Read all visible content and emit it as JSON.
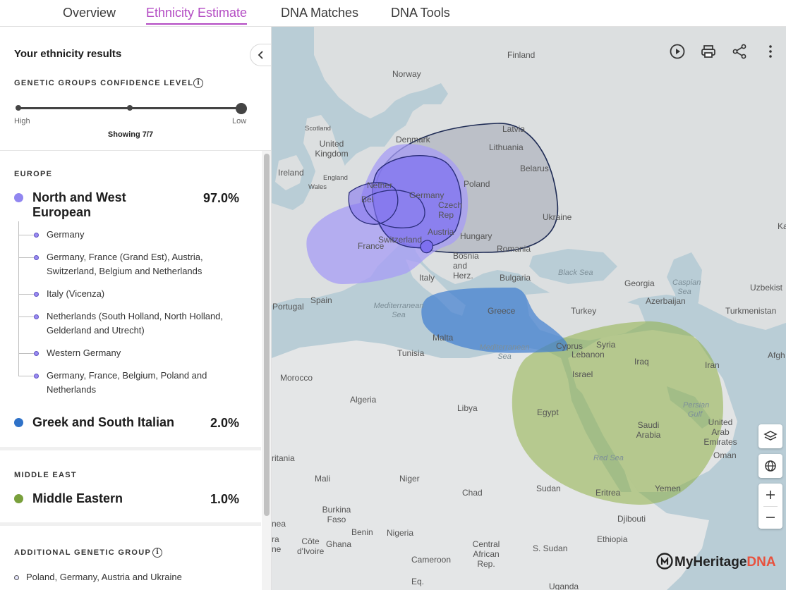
{
  "tabs": [
    {
      "label": "Overview"
    },
    {
      "label": "Ethnicity Estimate"
    },
    {
      "label": "DNA Matches"
    },
    {
      "label": "DNA Tools"
    }
  ],
  "panel": {
    "title": "Your ethnicity results",
    "confidence_label": "GENETIC GROUPS CONFIDENCE LEVEL",
    "slider": {
      "high_label": "High",
      "low_label": "Low",
      "level": 1.0
    },
    "showing": "Showing 7/7"
  },
  "sections": {
    "europe": {
      "title": "EUROPE",
      "groups": [
        {
          "name": "North and West European",
          "percent": "97.0%",
          "color": "#9186f0",
          "subgroups": [
            "Germany",
            "Germany, France (Grand Est), Austria, Switzerland, Belgium and Netherlands",
            "Italy (Vicenza)",
            "Netherlands (South Holland, North Holland, Gelderland and Utrecht)",
            "Western Germany",
            "Germany, France, Belgium, Poland and Netherlands"
          ]
        },
        {
          "name": "Greek and South Italian",
          "percent": "2.0%",
          "color": "#2f72c8"
        }
      ]
    },
    "middle_east": {
      "title": "MIDDLE EAST",
      "groups": [
        {
          "name": "Middle Eastern",
          "percent": "1.0%",
          "color": "#79a03c"
        }
      ]
    },
    "additional": {
      "title": "ADDITIONAL GENETIC GROUP",
      "items": [
        "Poland, Germany, Austria and Ukraine"
      ]
    }
  },
  "map": {
    "labels": {
      "finland": "Finland",
      "norway": "Norway",
      "latvia": "Latvia",
      "lithuania": "Lithuania",
      "denmark": "Denmark",
      "scotland": "Scotland",
      "uk": "United Kingdom",
      "ireland": "Ireland",
      "england": "England",
      "wales": "Wales",
      "netherlands": "Nether",
      "belarus": "Belarus",
      "poland": "Poland",
      "belgium": "Bel",
      "germany": "Germany",
      "czech": "Czech Rep",
      "ukraine": "Ukraine",
      "france": "France",
      "switzerland": "Switzerland",
      "austria": "Austria",
      "hungary": "Hungary",
      "romania": "Romania",
      "bosnia": "Bosnia and Herz.",
      "bulgaria": "Bulgaria",
      "italy": "Italy",
      "portugal": "Portugal",
      "spain": "Spain",
      "georgia": "Georgia",
      "azerbaijan": "Azerbaijan",
      "uzbekistan": "Uzbekist",
      "turkmenistan": "Turkmenistan",
      "turkey": "Turkey",
      "greece": "Greece",
      "syria": "Syria",
      "cyprus": "Cyprus",
      "lebanon": "Lebanon",
      "iraq": "Iraq",
      "iran": "Iran",
      "afghanistan": "Afgh",
      "kazakhstan": "Ka",
      "israel": "Israel",
      "malta": "Malta",
      "tunisia": "Tunisia",
      "morocco": "Morocco",
      "algeria": "Algeria",
      "libya": "Libya",
      "egypt": "Egypt",
      "saudi": "Saudi Arabia",
      "uae": "United Arab Emirates",
      "oman": "Oman",
      "yemen": "Yemen",
      "mauritania": "ritania",
      "mali": "Mali",
      "niger": "Niger",
      "chad": "Chad",
      "sudan": "Sudan",
      "eritrea": "Eritrea",
      "djibouti": "Djibouti",
      "ethiopia": "Ethiopia",
      "burkina": "Burkina Faso",
      "benin": "Benin",
      "nigeria": "Nigeria",
      "ghana": "Ghana",
      "cote": "Côte d'Ivoire",
      "guinea": "nea",
      "sierra": "ra ne",
      "car": "Central African Rep.",
      "ssudan": "S. Sudan",
      "cameroon": "Cameroon",
      "uganda": "Uganda",
      "eqguinea": "Eq.",
      "black_sea": "Black Sea",
      "caspian": "Caspian Sea",
      "med1": "Mediterranean Sea",
      "med2": "Mediterranean Sea",
      "red_sea": "Red Sea",
      "persian": "Persian Gulf"
    },
    "logo": {
      "brand": "MyHeritage",
      "suffix": "DNA"
    }
  }
}
